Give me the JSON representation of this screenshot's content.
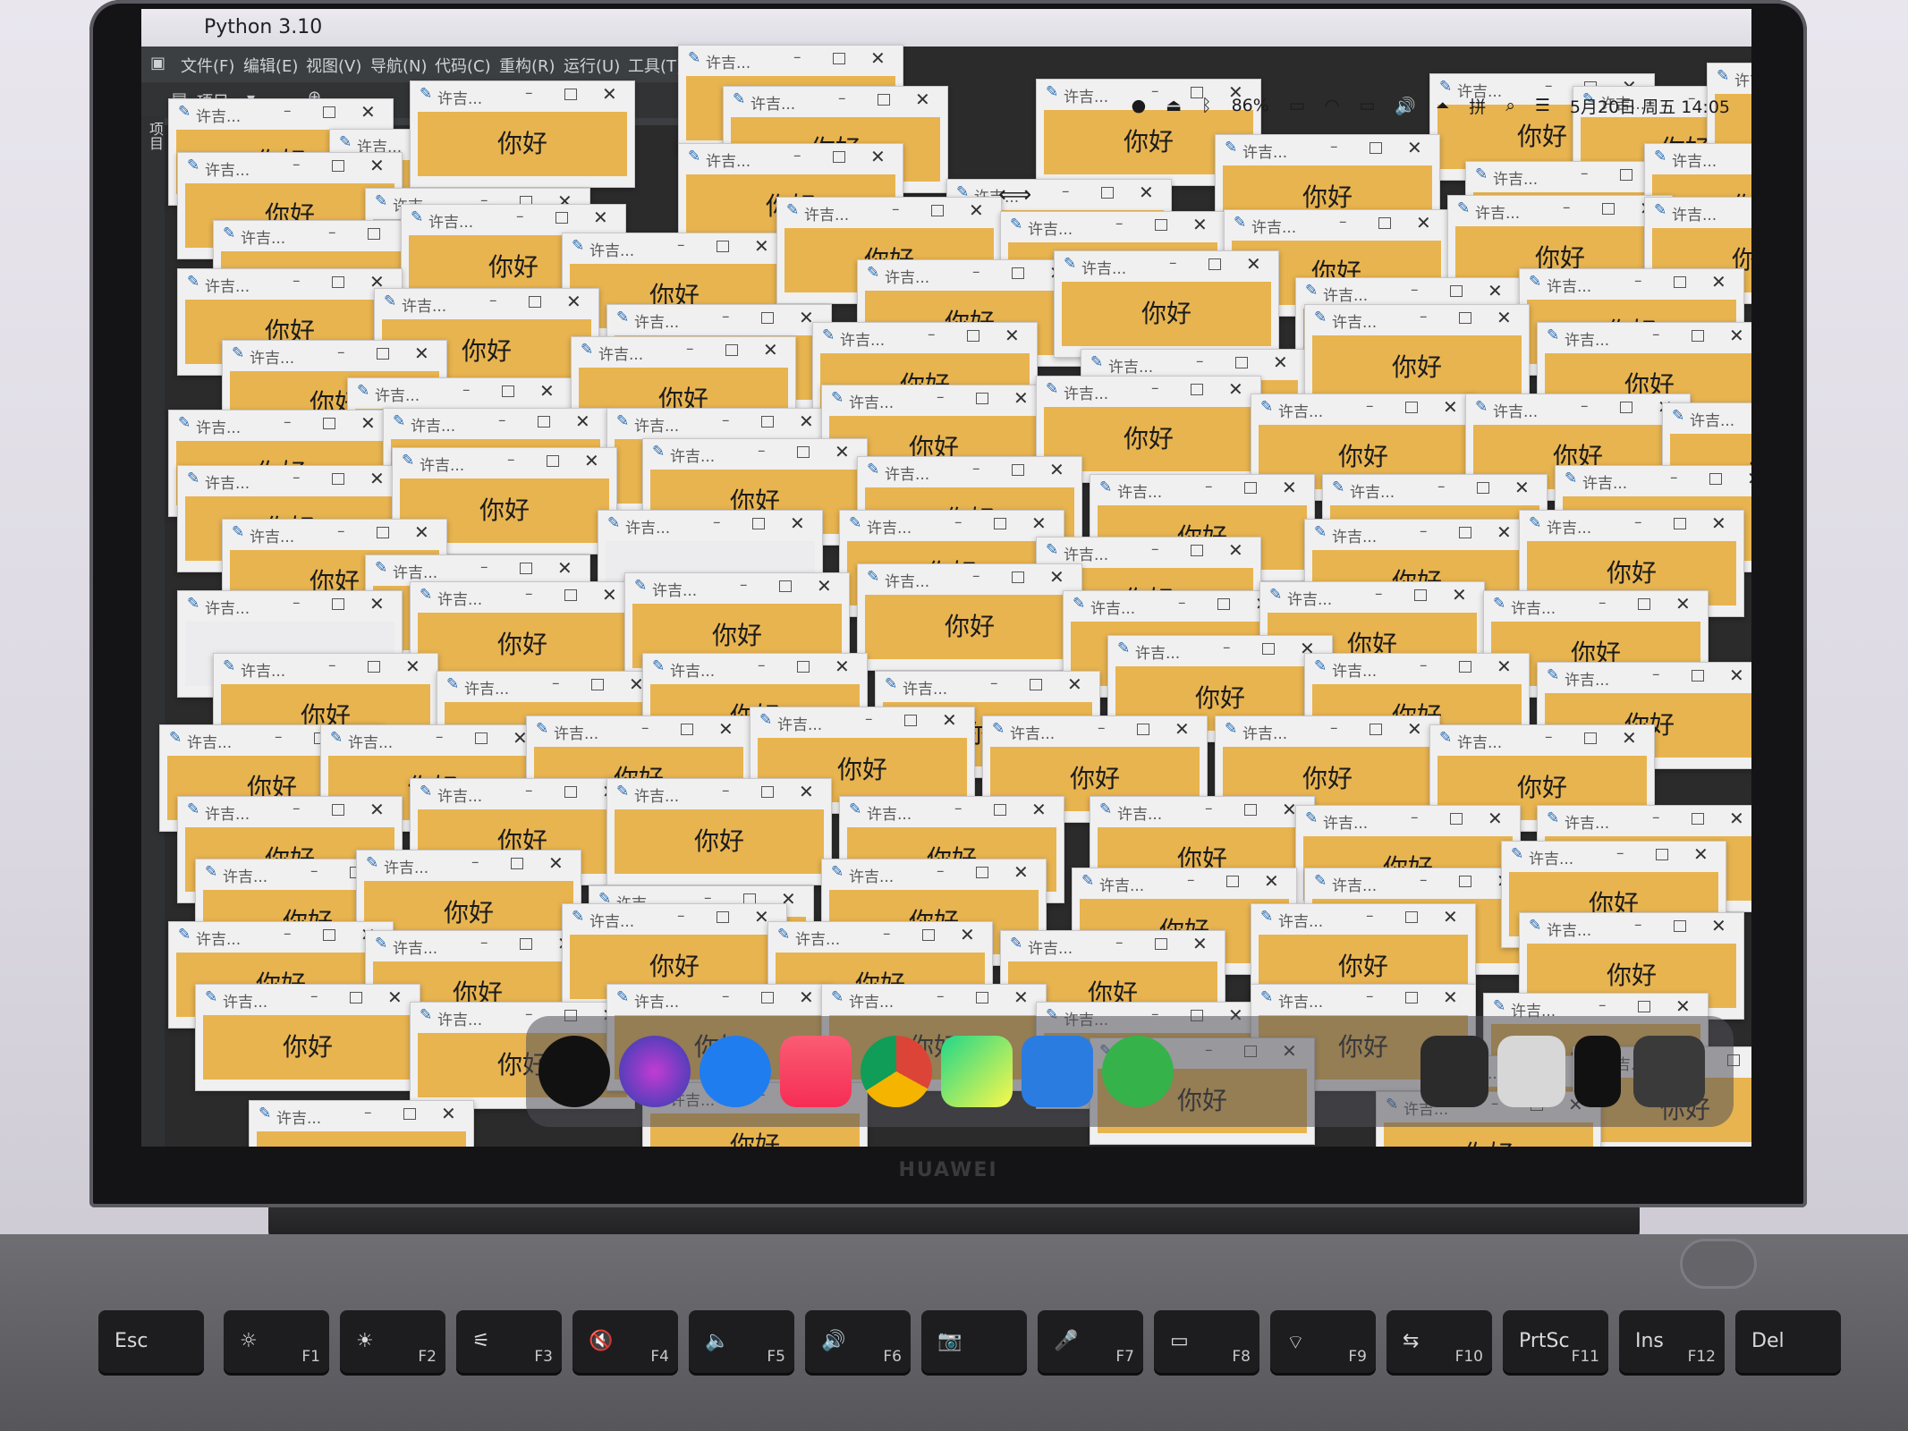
{
  "menubar": {
    "app_name": "Python 3.10",
    "battery": "86%",
    "datetime": "5月20日 周五 14:05"
  },
  "ide": {
    "menus": [
      "文件(F)",
      "编辑(E)",
      "视图(V)",
      "导航(N)",
      "代码(C)",
      "重构(R)",
      "运行(U)",
      "工具(T)"
    ],
    "project_label": "项目",
    "side_label": "项目"
  },
  "dialog": {
    "title": "许吉...",
    "message": "你好"
  },
  "dock": {
    "items": [
      "clock-app",
      "siri",
      "safari",
      "music",
      "chrome",
      "pycharm",
      "finder",
      "keynote"
    ]
  },
  "laptop": {
    "brand": "HUAWEI"
  },
  "keyboard": {
    "keys": [
      {
        "label": "Esc",
        "sub": ""
      },
      {
        "label": "☼",
        "sub": "F1"
      },
      {
        "label": "☀",
        "sub": "F2"
      },
      {
        "label": "⚟",
        "sub": "F3"
      },
      {
        "label": "🔇",
        "sub": "F4"
      },
      {
        "label": "🔈",
        "sub": "F5"
      },
      {
        "label": "🔊",
        "sub": "F6"
      },
      {
        "label": "📷",
        "sub": ""
      },
      {
        "label": "🎤",
        "sub": "F7"
      },
      {
        "label": "▭",
        "sub": "F8"
      },
      {
        "label": "⌔",
        "sub": "F9"
      },
      {
        "label": "⇆",
        "sub": "F10"
      },
      {
        "label": "PrtSc",
        "sub": "F11"
      },
      {
        "label": "Ins",
        "sub": "F12"
      },
      {
        "label": "Del",
        "sub": ""
      }
    ]
  },
  "colors": {
    "dialog_label": "#e8b450",
    "dialog_frame": "#f1f0f1",
    "ide_bg": "#3c3f41"
  }
}
